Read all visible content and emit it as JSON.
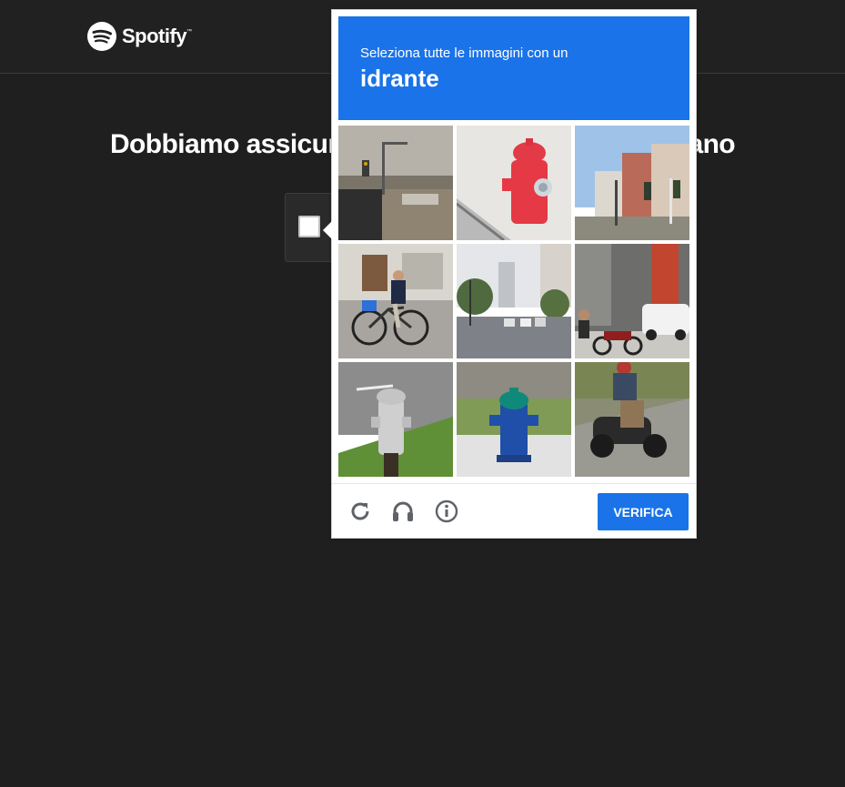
{
  "brand": {
    "name": "Spotify",
    "tm": "™"
  },
  "page": {
    "heading": "Dobbiamo assicurarci che tu sia un essere umano"
  },
  "captcha": {
    "instruction": "Seleziona tutte le immagini con un",
    "keyword": "idrante",
    "verify_label": "VERIFICA",
    "accent_color": "#1a73e8",
    "tiles": [
      {
        "subject": "traffic-light-rural-road"
      },
      {
        "subject": "red-fire-hydrant-closeup"
      },
      {
        "subject": "traffic-lights-city-street"
      },
      {
        "subject": "cyclist-on-bicycle"
      },
      {
        "subject": "city-street-cars"
      },
      {
        "subject": "motorcycle-parked-street"
      },
      {
        "subject": "silver-fire-hydrant"
      },
      {
        "subject": "blue-green-fire-hydrant"
      },
      {
        "subject": "rider-on-scooter"
      }
    ],
    "footer_icons": [
      "reload-icon",
      "headphones-icon",
      "info-icon"
    ]
  }
}
